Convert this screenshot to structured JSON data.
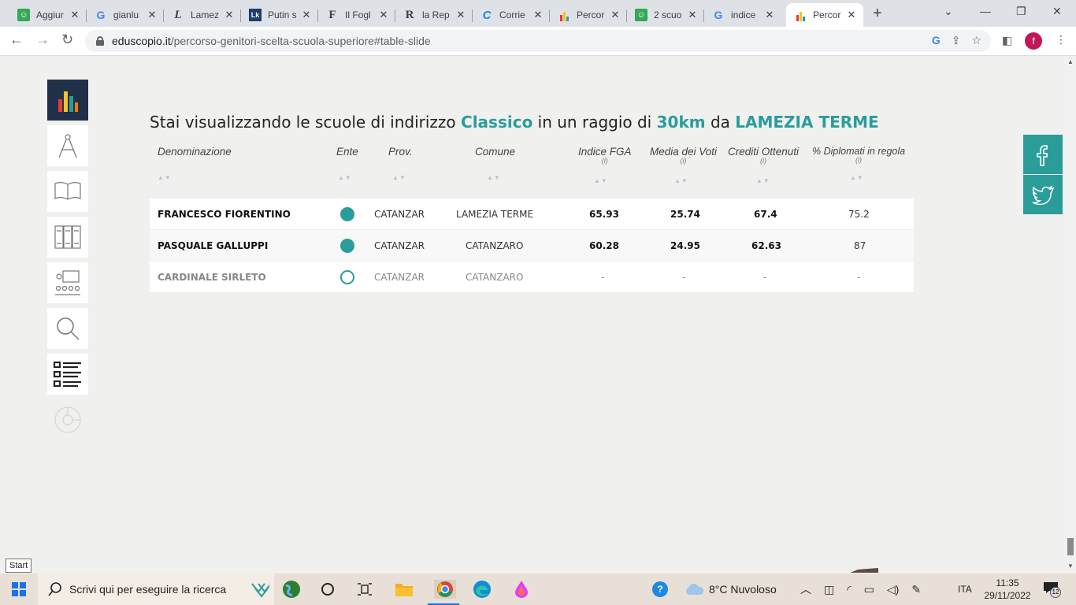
{
  "browser": {
    "tabs": [
      {
        "title": "Aggiur",
        "icon": "green-person-icon"
      },
      {
        "title": "gianlu",
        "icon": "google-icon"
      },
      {
        "title": "Lamez",
        "icon": "l-letter-icon"
      },
      {
        "title": "Putin s",
        "icon": "lk-icon"
      },
      {
        "title": "Il Fogl",
        "icon": "f-letter-icon"
      },
      {
        "title": "la Rep",
        "icon": "r-letter-icon"
      },
      {
        "title": "Corrie",
        "icon": "c-letter-icon"
      },
      {
        "title": "Percor",
        "icon": "bars-icon"
      },
      {
        "title": "2 scuo",
        "icon": "green-person-icon"
      },
      {
        "title": "indice",
        "icon": "google-icon"
      },
      {
        "title": "Percor",
        "icon": "bars-icon",
        "active": true
      }
    ],
    "url_domain": "eduscopio.it",
    "url_path": "/percorso-genitori-scelta-scuola-superiore#table-slide",
    "profile_initial": "f"
  },
  "page": {
    "title_pre": "Stai visualizzando le scuole di indirizzo ",
    "title_indirizzo": "Classico",
    "title_mid": " in un raggio di ",
    "title_radius": "30km",
    "title_da": " da ",
    "title_city": "LAMEZIA TERME",
    "accent_color": "#2a9d9a",
    "info_glyph": "(i)",
    "sort_glyph": "▲▼",
    "columns": [
      "Denominazione",
      "Ente",
      "Prov.",
      "Comune",
      "Indice FGA",
      "Media dei Voti",
      "Crediti Ottenuti",
      "% Diplomati in regola"
    ],
    "rows": [
      {
        "name": "FRANCESCO FIORENTINO",
        "ente": "filled",
        "prov": "CATANZAR",
        "comune": "LAMEZIA TERME",
        "fga": "65.93",
        "media": "25.74",
        "crediti": "67.4",
        "diplomati": "75.2"
      },
      {
        "name": "PASQUALE GALLUPPI",
        "ente": "filled",
        "prov": "CATANZAR",
        "comune": "CATANZARO",
        "fga": "60.28",
        "media": "24.95",
        "crediti": "62.63",
        "diplomati": "87"
      },
      {
        "name": "CARDINALE SIRLETO",
        "ente": "hollow",
        "prov": "CATANZAR",
        "comune": "CATANZARO",
        "fga": "-",
        "media": "-",
        "crediti": "-",
        "diplomati": "-"
      }
    ],
    "start_tooltip": "Start"
  },
  "taskbar": {
    "search_placeholder": "Scrivi qui per eseguire la ricerca",
    "weather": "8°C  Nuvoloso",
    "language": "ITA",
    "time": "11:35",
    "date": "29/11/2022",
    "notifications": "12"
  }
}
